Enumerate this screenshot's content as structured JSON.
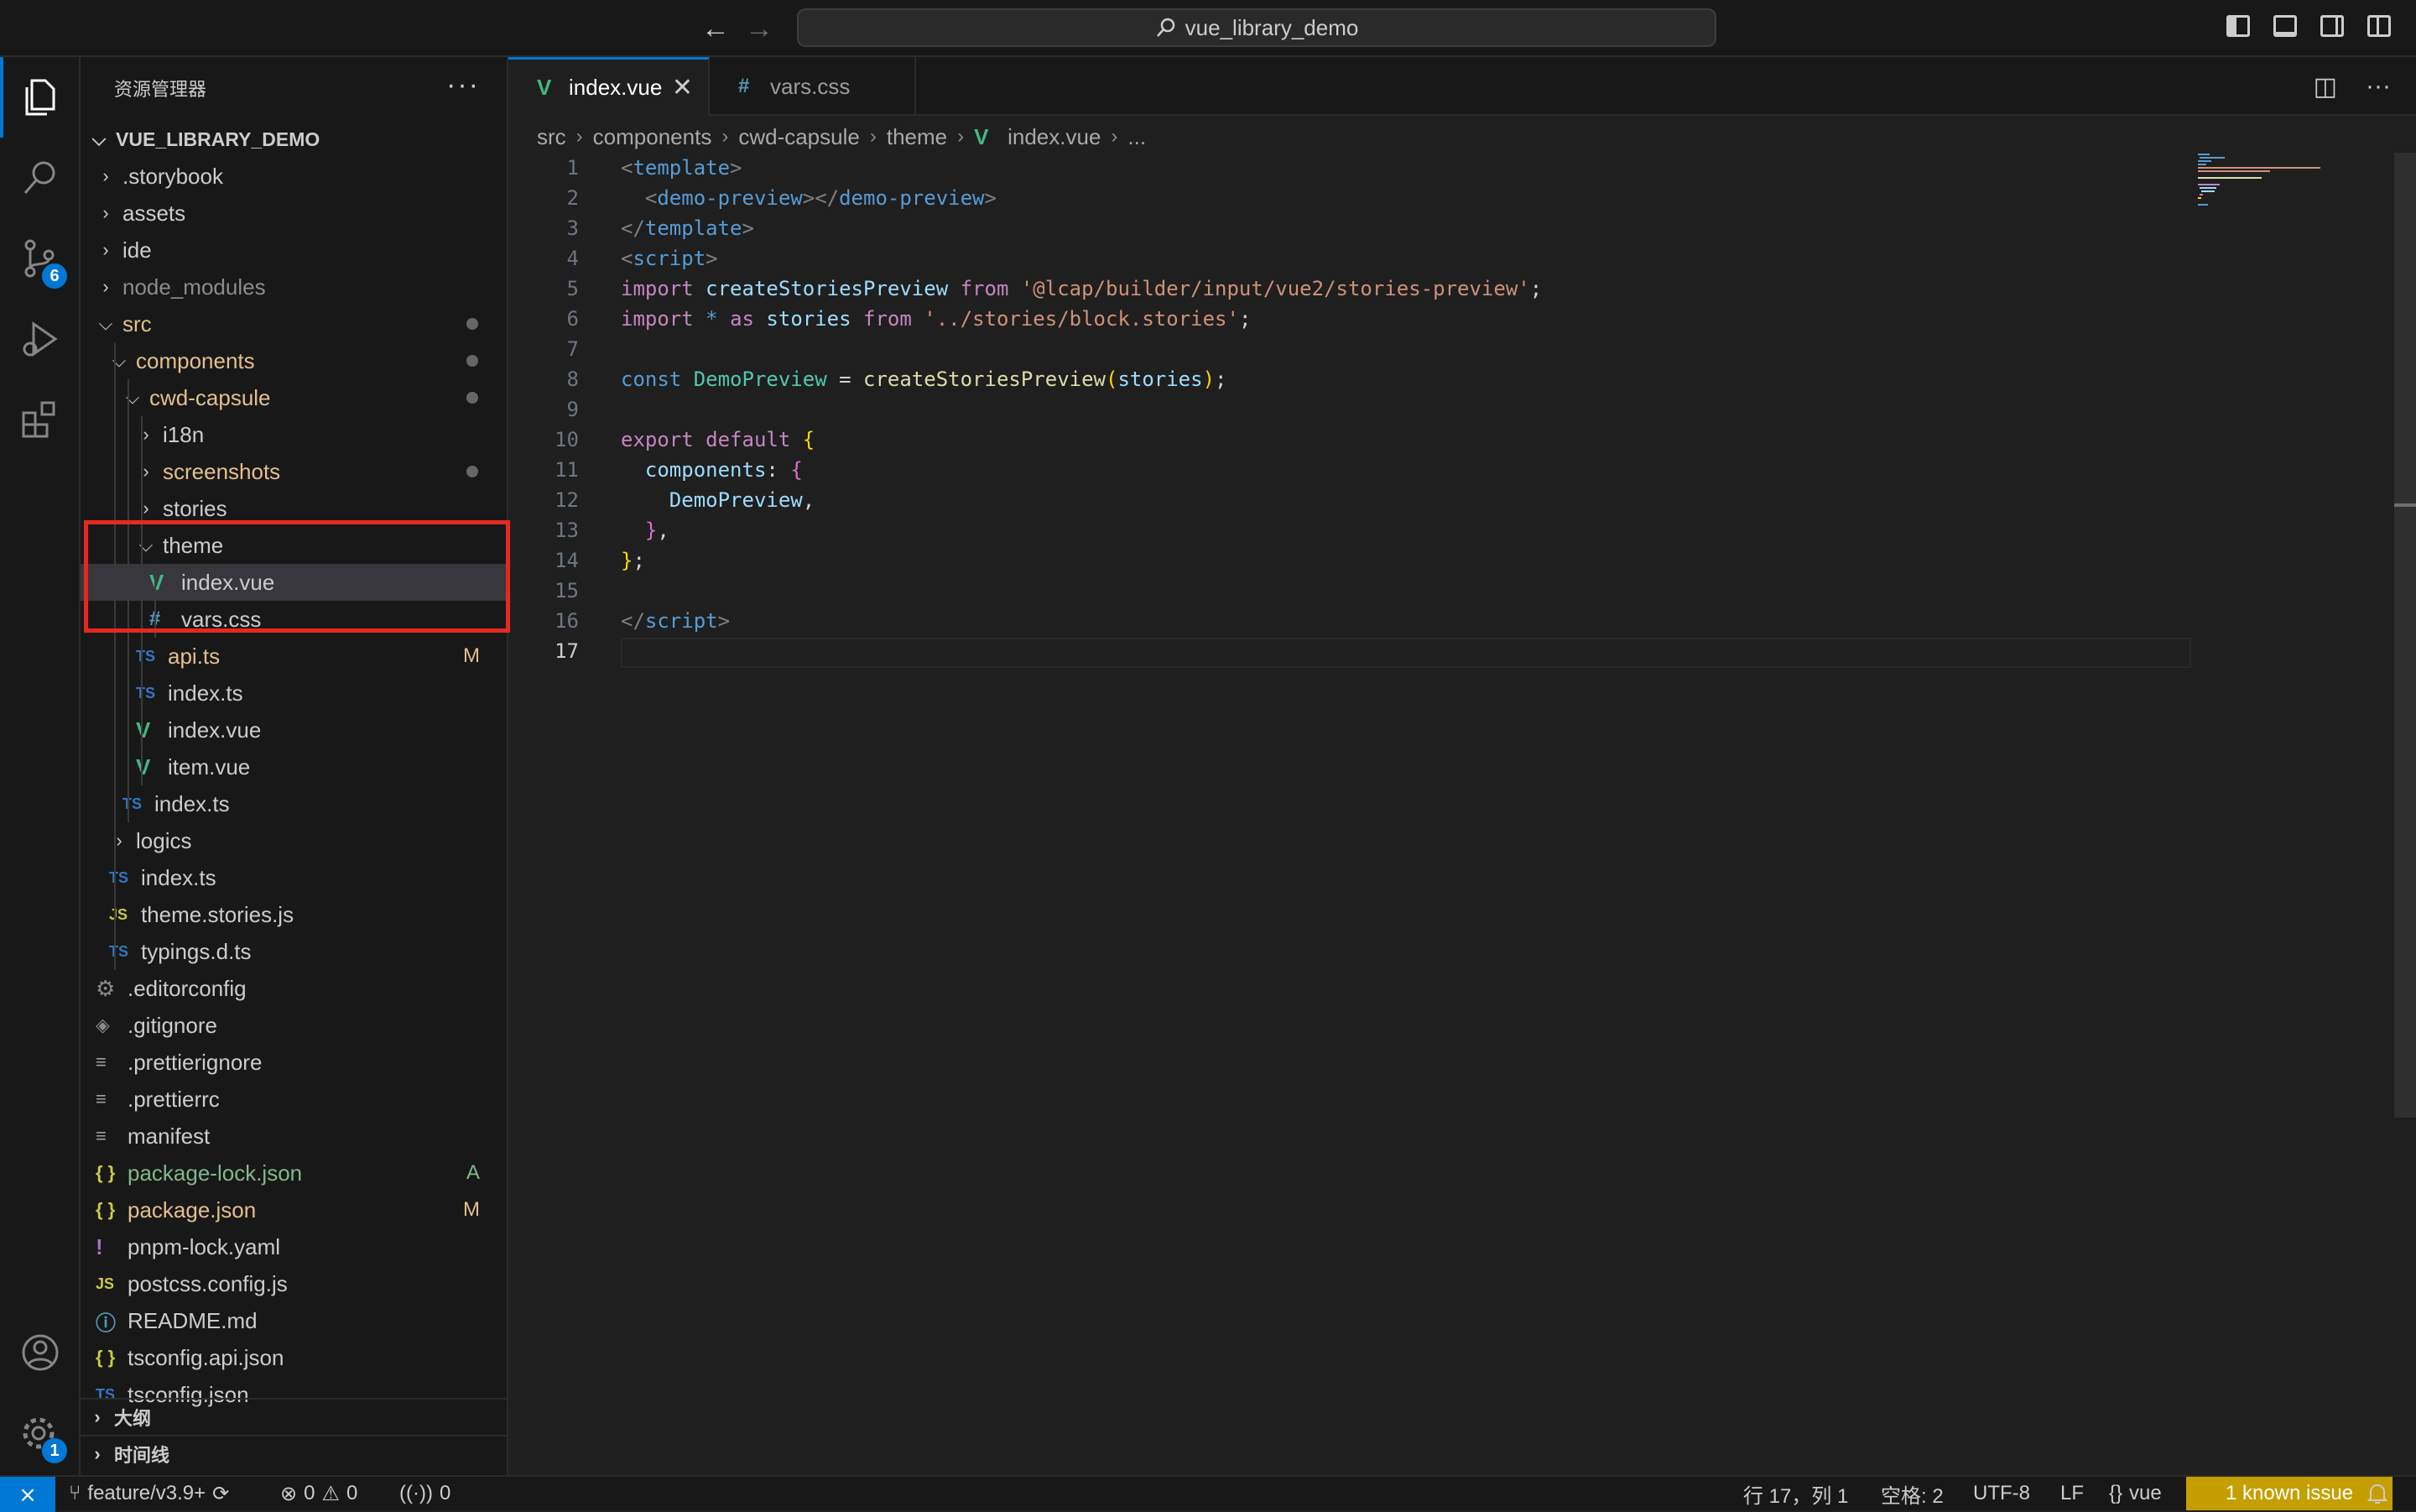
{
  "titlebar": {
    "search_text": "vue_library_demo"
  },
  "activitybar": {
    "scm_badge": "6",
    "settings_badge": "1"
  },
  "sidebar": {
    "title": "资源管理器",
    "root": "VUE_LIBRARY_DEMO",
    "tree": [
      {
        "label": ".storybook",
        "type": "folder",
        "open": false,
        "depth": 0,
        "color": "#cccccc"
      },
      {
        "label": "assets",
        "type": "folder",
        "open": false,
        "depth": 0,
        "color": "#cccccc"
      },
      {
        "label": "ide",
        "type": "folder",
        "open": false,
        "depth": 0,
        "color": "#cccccc"
      },
      {
        "label": "node_modules",
        "type": "folder",
        "open": false,
        "depth": 0,
        "color": "#8c8c8c"
      },
      {
        "label": "src",
        "type": "folder",
        "open": true,
        "depth": 0,
        "color": "#e2c08d",
        "dot": true
      },
      {
        "label": "components",
        "type": "folder",
        "open": true,
        "depth": 1,
        "color": "#e2c08d",
        "dot": true
      },
      {
        "label": "cwd-capsule",
        "type": "folder",
        "open": true,
        "depth": 2,
        "color": "#e2c08d",
        "dot": true
      },
      {
        "label": "i18n",
        "type": "folder",
        "open": false,
        "depth": 3,
        "color": "#cccccc"
      },
      {
        "label": "screenshots",
        "type": "folder",
        "open": false,
        "depth": 3,
        "color": "#e2c08d",
        "dot": true
      },
      {
        "label": "stories",
        "type": "folder",
        "open": false,
        "depth": 3,
        "color": "#cccccc"
      },
      {
        "label": "theme",
        "type": "folder",
        "open": true,
        "depth": 3,
        "color": "#cccccc"
      },
      {
        "label": "index.vue",
        "type": "vue",
        "depth": 4,
        "color": "#cccccc",
        "selected": true
      },
      {
        "label": "vars.css",
        "type": "css",
        "depth": 4,
        "color": "#cccccc"
      },
      {
        "label": "api.ts",
        "type": "ts",
        "depth": 3,
        "color": "#e2c08d",
        "deco": "M"
      },
      {
        "label": "index.ts",
        "type": "ts",
        "depth": 3,
        "color": "#cccccc"
      },
      {
        "label": "index.vue",
        "type": "vue",
        "depth": 3,
        "color": "#cccccc"
      },
      {
        "label": "item.vue",
        "type": "vue",
        "depth": 3,
        "color": "#cccccc"
      },
      {
        "label": "index.ts",
        "type": "ts",
        "depth": 2,
        "color": "#cccccc"
      },
      {
        "label": "logics",
        "type": "folder",
        "open": false,
        "depth": 1,
        "color": "#cccccc"
      },
      {
        "label": "index.ts",
        "type": "ts",
        "depth": 1,
        "color": "#cccccc"
      },
      {
        "label": "theme.stories.js",
        "type": "js",
        "depth": 1,
        "color": "#cccccc"
      },
      {
        "label": "typings.d.ts",
        "type": "ts",
        "depth": 1,
        "color": "#cccccc"
      },
      {
        "label": ".editorconfig",
        "type": "gear",
        "depth": 0,
        "color": "#cccccc"
      },
      {
        "label": ".gitignore",
        "type": "git",
        "depth": 0,
        "color": "#cccccc"
      },
      {
        "label": ".prettierignore",
        "type": "lines",
        "depth": 0,
        "color": "#cccccc"
      },
      {
        "label": ".prettierrc",
        "type": "lines",
        "depth": 0,
        "color": "#cccccc"
      },
      {
        "label": "manifest",
        "type": "lines",
        "depth": 0,
        "color": "#cccccc"
      },
      {
        "label": "package-lock.json",
        "type": "json",
        "depth": 0,
        "color": "#81b88b",
        "deco": "A"
      },
      {
        "label": "package.json",
        "type": "json",
        "depth": 0,
        "color": "#e2c08d",
        "deco": "M"
      },
      {
        "label": "pnpm-lock.yaml",
        "type": "yaml",
        "depth": 0,
        "color": "#cccccc"
      },
      {
        "label": "postcss.config.js",
        "type": "js",
        "depth": 0,
        "color": "#cccccc"
      },
      {
        "label": "README.md",
        "type": "info",
        "depth": 0,
        "color": "#cccccc"
      },
      {
        "label": "tsconfig.api.json",
        "type": "json",
        "depth": 0,
        "color": "#cccccc"
      },
      {
        "label": "tsconfig.json",
        "type": "tsbox",
        "depth": 0,
        "color": "#cccccc"
      }
    ],
    "outline_label": "大纲",
    "timeline_label": "时间线"
  },
  "editor": {
    "tabs": [
      {
        "label": "index.vue"
      },
      {
        "label": "vars.css"
      }
    ],
    "breadcrumb": [
      "src",
      "components",
      "cwd-capsule",
      "theme",
      "index.vue",
      "..."
    ],
    "lines": [
      [
        [
          "tagb",
          "<"
        ],
        [
          "tag",
          "template"
        ],
        [
          "tagb",
          ">"
        ]
      ],
      [
        [
          "",
          "  "
        ],
        [
          "tagb",
          "<"
        ],
        [
          "tag",
          "demo-preview"
        ],
        [
          "tagb",
          "></"
        ],
        [
          "tag",
          "demo-preview"
        ],
        [
          "tagb",
          ">"
        ]
      ],
      [
        [
          "tagb",
          "</"
        ],
        [
          "tag",
          "template"
        ],
        [
          "tagb",
          ">"
        ]
      ],
      [
        [
          "tagb",
          "<"
        ],
        [
          "tag",
          "script"
        ],
        [
          "tagb",
          ">"
        ]
      ],
      [
        [
          "kw",
          "import "
        ],
        [
          "var",
          "createStoriesPreview "
        ],
        [
          "kw",
          "from "
        ],
        [
          "str",
          "'@lcap/builder/input/vue2/stories-preview'"
        ],
        [
          "",
          ";"
        ]
      ],
      [
        [
          "kw",
          "import "
        ],
        [
          "kwb",
          "* "
        ],
        [
          "kw",
          "as "
        ],
        [
          "var",
          "stories "
        ],
        [
          "kw",
          "from "
        ],
        [
          "str",
          "'../stories/block.stories'"
        ],
        [
          "",
          ";"
        ]
      ],
      [],
      [
        [
          "kwb",
          "const "
        ],
        [
          "cls",
          "DemoPreview "
        ],
        [
          "",
          "= "
        ],
        [
          "fn",
          "createStoriesPreview"
        ],
        [
          "br1",
          "("
        ],
        [
          "var",
          "stories"
        ],
        [
          "br1",
          ")"
        ],
        [
          "",
          ";"
        ]
      ],
      [],
      [
        [
          "kw",
          "export default "
        ],
        [
          "br1",
          "{"
        ]
      ],
      [
        [
          "",
          "  "
        ],
        [
          "var",
          "components"
        ],
        [
          "",
          ": "
        ],
        [
          "br2",
          "{"
        ]
      ],
      [
        [
          "",
          "    "
        ],
        [
          "var",
          "DemoPreview"
        ],
        [
          "",
          ","
        ]
      ],
      [
        [
          "",
          "  "
        ],
        [
          "br2",
          "}"
        ],
        [
          "",
          ","
        ]
      ],
      [
        [
          "br1",
          "}"
        ],
        [
          "",
          ";"
        ]
      ],
      [],
      [
        [
          "tagb",
          "</"
        ],
        [
          "tag",
          "script"
        ],
        [
          "tagb",
          ">"
        ]
      ],
      []
    ],
    "current_line": 17
  },
  "statusbar": {
    "branch": "feature/v3.9+",
    "errors": "0",
    "warnings": "0",
    "ports": "0",
    "position": "行 17，列 1",
    "spaces": "空格: 2",
    "encoding": "UTF-8",
    "eol": "LF",
    "language": "vue",
    "known_issue": "1 known issue"
  }
}
